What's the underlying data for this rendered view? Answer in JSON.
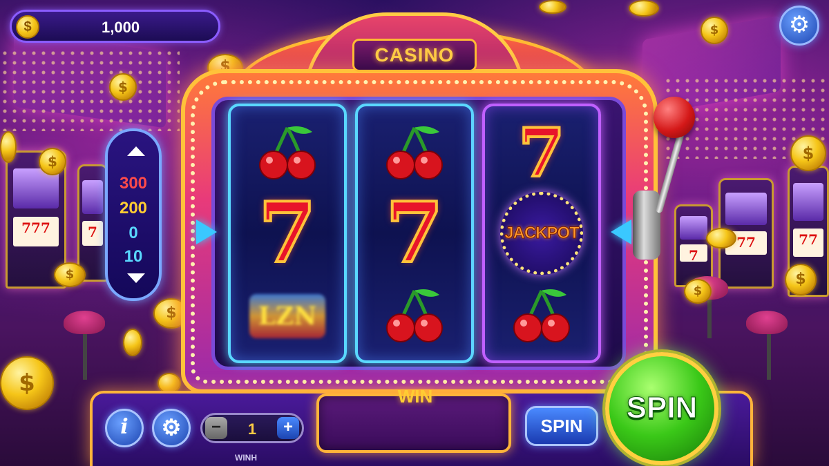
{
  "balance": {
    "value": "1,000",
    "coin_symbol": "$"
  },
  "top_settings_icon": "gear-icon",
  "marquee": {
    "title": "CASINO"
  },
  "paytable": {
    "values": [
      "300",
      "200",
      "0",
      "10"
    ],
    "colors": [
      "#ff4a4a",
      "#ffcc33",
      "#5ad8ff",
      "#5ad8ff"
    ]
  },
  "reels": [
    {
      "top": "cherry",
      "middle": "seven",
      "bottom": "blurred-symbol"
    },
    {
      "top": "cherry",
      "middle": "seven",
      "bottom": "cherry"
    },
    {
      "top": "seven",
      "middle": "jackpot",
      "bottom": "cherry"
    }
  ],
  "symbols": {
    "seven": "7",
    "jackpot": "JACKPOT",
    "blurred": "LZN"
  },
  "controls": {
    "info_label": "i",
    "bet_value": "1",
    "minus_label": "−",
    "plus_label": "+",
    "bet_caption": "WINH",
    "win_label": "WIN",
    "win_value": "",
    "spin_small_label": "SPIN",
    "spin_big_label": "SPIN"
  },
  "colors": {
    "accent_gold": "#ffc23a",
    "neon_blue": "#5ad8ff",
    "spin_green": "#3ac818",
    "seven_red": "#e8142a"
  }
}
